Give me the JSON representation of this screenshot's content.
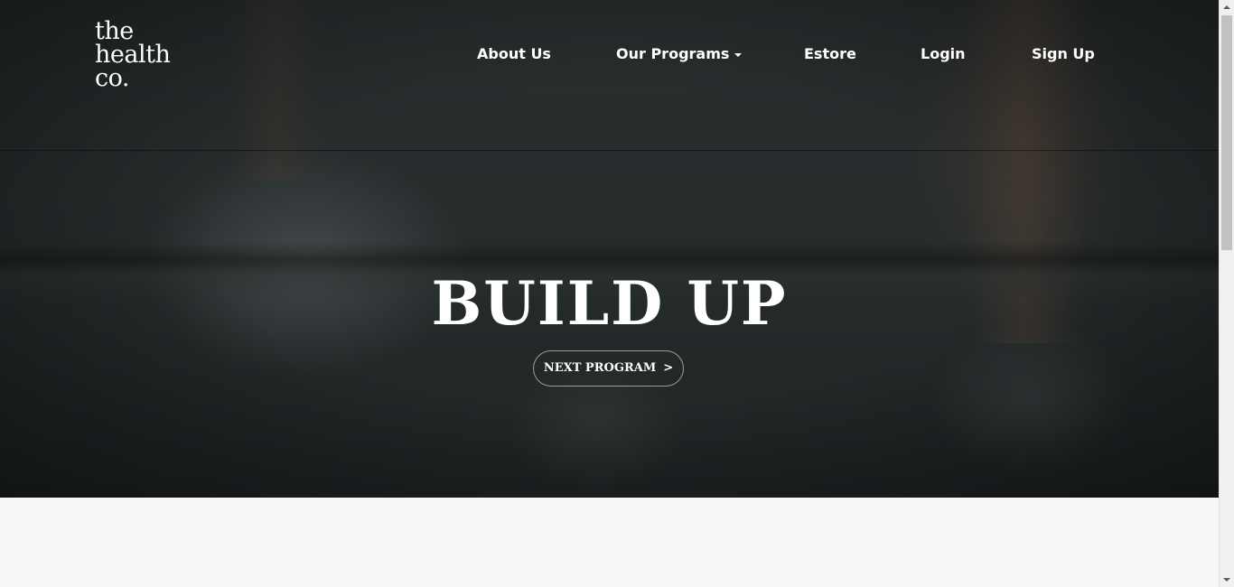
{
  "brand": {
    "logo_line1": "the",
    "logo_line2": "health",
    "logo_line3": "co."
  },
  "nav": {
    "items": [
      {
        "label": "About Us"
      },
      {
        "label": "Our Programs"
      },
      {
        "label": "Estore"
      },
      {
        "label": "Login"
      },
      {
        "label": "Sign Up"
      }
    ]
  },
  "hero": {
    "title": "BUILD UP",
    "button_label": "NEXT PROGRAM",
    "button_arrow": ">"
  },
  "colors": {
    "hero_background": "#262b2c",
    "text": "#ffffff",
    "page_background": "#f8f8f8"
  }
}
